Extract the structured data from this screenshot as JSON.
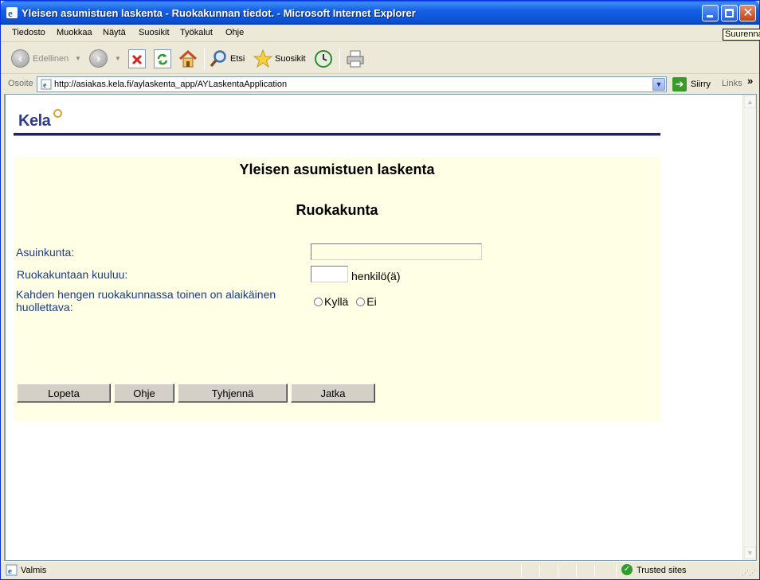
{
  "window": {
    "title": "Yleisen asumistuen laskenta - Ruokakunnan tiedot. - Microsoft Internet Explorer",
    "tooltip": "Suurenna"
  },
  "menu": {
    "items": [
      "Tiedosto",
      "Muokkaa",
      "Näytä",
      "Suosikit",
      "Työkalut",
      "Ohje"
    ]
  },
  "toolbar": {
    "back_label": "Edellinen",
    "search_label": "Etsi",
    "favorites_label": "Suosikit"
  },
  "address": {
    "label": "Osoite",
    "url": "http://asiakas.kela.fi/aylaskenta_app/AYLaskentaApplication",
    "go_label": "Siirry",
    "links_label": "Links"
  },
  "page": {
    "logo_text": "Kela",
    "title": "Yleisen asumistuen laskenta",
    "subtitle": "Ruokakunta",
    "fields": {
      "municipality_label": "Asuinkunta:",
      "municipality_value": "",
      "household_label": "Ruokakuntaan kuuluu:",
      "household_value": "",
      "household_suffix": "henkilö(ä)",
      "minor_label_line1": "Kahden hengen ruokakunnassa toinen on alaikäinen",
      "minor_label_line2": "huollettava:",
      "radio_yes": "Kyllä",
      "radio_no": "Ei"
    },
    "buttons": {
      "quit": "Lopeta",
      "help": "Ohje",
      "clear": "Tyhjennä",
      "continue": "Jatka"
    }
  },
  "status": {
    "text": "Valmis",
    "zone": "Trusted sites"
  },
  "colors": {
    "panel_bg": "#ffffe5",
    "label_blue": "#1a3a8a",
    "rule": "#1f2266",
    "kela_blue": "#2e3c8a"
  }
}
